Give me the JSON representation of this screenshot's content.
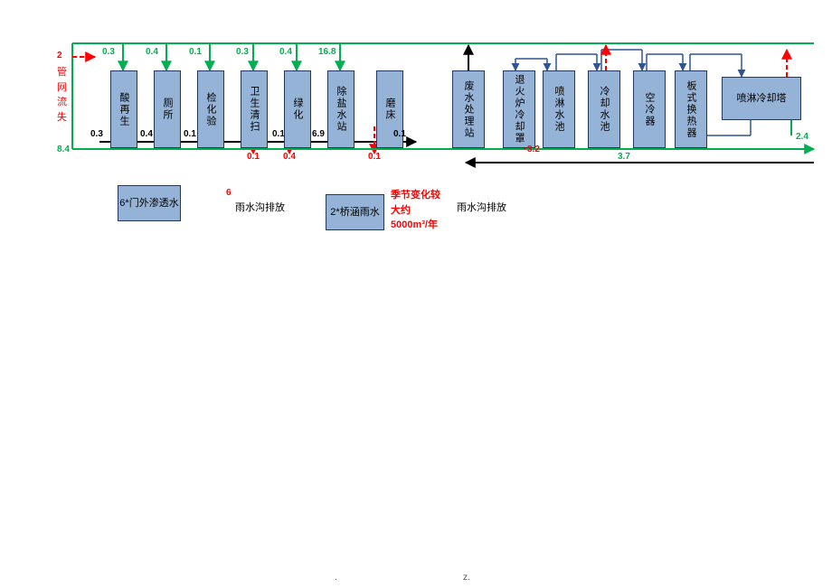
{
  "boxes_top": [
    {
      "label": "酸再生"
    },
    {
      "label": "厕所"
    },
    {
      "label": "检化验"
    },
    {
      "label": "卫生清扫"
    },
    {
      "label": "绿化"
    },
    {
      "label": "除盐水站"
    },
    {
      "label": "磨床"
    }
  ],
  "boxes_mid": [
    {
      "label": "废水处理站"
    },
    {
      "label": "退火炉冷却罩"
    },
    {
      "label": "喷淋水池"
    },
    {
      "label": "冷却水池"
    },
    {
      "label": "空冷器"
    },
    {
      "label": "板式换热器"
    }
  ],
  "box_right": {
    "label": "喷淋冷却塔"
  },
  "boxes_bottom": [
    {
      "label": "6*门外渗透水"
    },
    {
      "label": "2*桥涵雨水"
    }
  ],
  "nums_green_top": [
    "0.3",
    "0.4",
    "0.1",
    "0.3",
    "0.4",
    "16.8"
  ],
  "nums_black_bottom": [
    "0.3",
    "0.4",
    "0.1",
    "0.1",
    "6.9",
    "0.1"
  ],
  "nums_red_below": [
    "0.1",
    "0.4",
    "0.1"
  ],
  "green_left": "8.4",
  "green_right": "2.4",
  "red_top_left_val": "2",
  "red_top_left_label": "管网流失",
  "red_mid_a": "3.2",
  "green_mid_b": "3.7",
  "red_bottom_a": "6",
  "bottom_note1": "雨水沟排放",
  "bottom_note2": "季节变化较大约5000m³/年",
  "bottom_note3": "雨水沟排放",
  "footer_left": ".",
  "footer_right": "z."
}
